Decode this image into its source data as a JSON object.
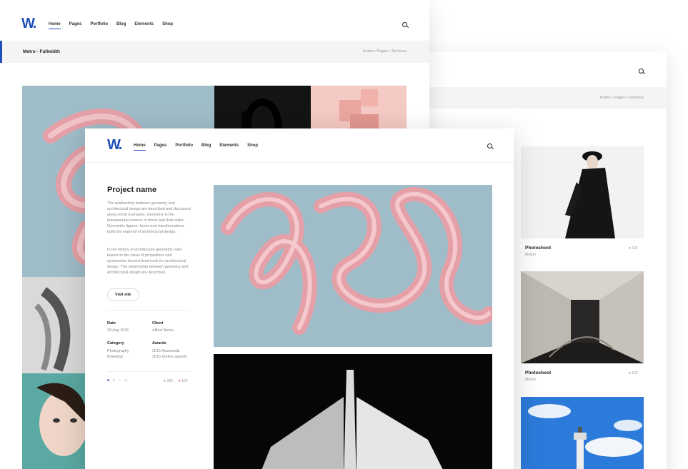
{
  "back_card": {
    "nav": [
      "Home",
      "Pages",
      "Portfolio",
      "Blog",
      "Elements",
      "Shop"
    ],
    "page_title": "Metro - Fullwidth",
    "breadcrumb": [
      "Home",
      "Pages",
      "Services"
    ]
  },
  "right_card": {
    "breadcrumb": [
      "Home",
      "Pages",
      "Services"
    ],
    "items": [
      {
        "title": "Photoshoot",
        "category": "Motion",
        "likes": "102"
      },
      {
        "title": "Photoshoot",
        "category": "Motion",
        "likes": "102"
      }
    ]
  },
  "front_card": {
    "logo": "W.",
    "nav": [
      "Home",
      "Pages",
      "Portfolio",
      "Blog",
      "Elements",
      "Shop"
    ],
    "project_title": "Project name",
    "para1": "The relationship between geometry and architectural design are described and discussed along some examples. Geometry is the fundamental science of forms and their order. Geometric figures, forms and transformations build the material of architectural design.",
    "para2": "In the history of architecture geometric rules based on the ideas of proportions and symmetries formed fixed tools for architectural design. The relationship between geometry and architectural design are described.",
    "visit_label": "Visit site",
    "meta": {
      "date_label": "Date",
      "date_value": "28 Aug 2016",
      "client_label": "Client",
      "client_value": "Alfred Norris",
      "category_label": "Category",
      "category_values": [
        "Photography",
        "Branding"
      ],
      "awards_label": "Awards",
      "awards_values": [
        "2015 Awwwards",
        "2015 Dieline awards"
      ]
    },
    "views": "365",
    "likes": "102"
  },
  "colors": {
    "accent": "#1f4fb8",
    "swirl_bg": "#9fbcc9",
    "pink": "#e9a7ad"
  }
}
